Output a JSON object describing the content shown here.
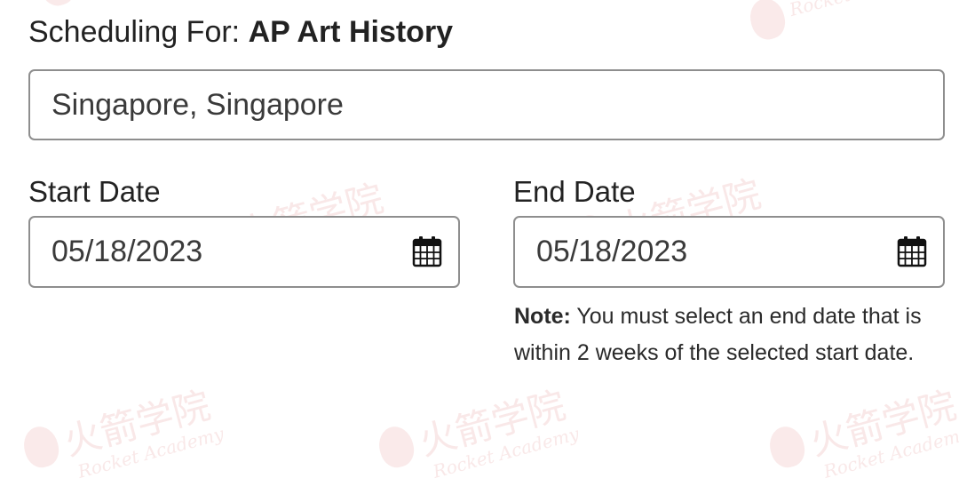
{
  "watermark": {
    "cn": "火箭学院",
    "en": "Rocket Academy"
  },
  "scheduling": {
    "prefix": "Scheduling For:",
    "course": "AP Art History"
  },
  "location": {
    "value": "Singapore, Singapore"
  },
  "start_date": {
    "label": "Start Date",
    "value": "05/18/2023",
    "icon": "calendar-icon"
  },
  "end_date": {
    "label": "End Date",
    "value": "05/18/2023",
    "icon": "calendar-icon"
  },
  "note": {
    "label": "Note:",
    "text": "You must select an end date that is within 2 weeks of the selected start date."
  }
}
